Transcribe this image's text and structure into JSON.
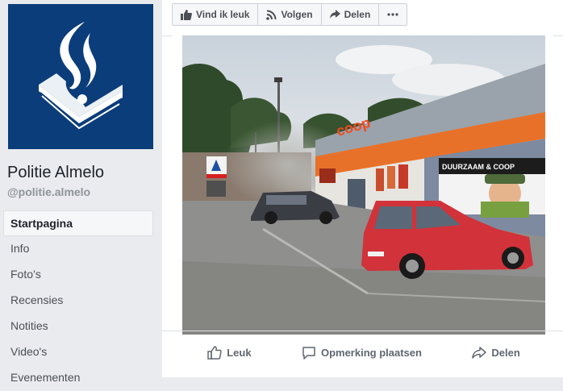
{
  "page": {
    "name": "Politie Almelo",
    "handle": "@politie.almelo"
  },
  "nav": {
    "items": [
      {
        "label": "Startpagina",
        "active": true
      },
      {
        "label": "Info"
      },
      {
        "label": "Foto’s"
      },
      {
        "label": "Recensies"
      },
      {
        "label": "Notities"
      },
      {
        "label": "Video's"
      },
      {
        "label": "Evenementen"
      }
    ]
  },
  "actions": {
    "like": "Vind ik leuk",
    "follow": "Volgen",
    "share": "Delen",
    "more_icon": "more-icon"
  },
  "post": {
    "photo": {
      "sign_left": "DUURZAAM & COOP",
      "shop_logo": "coop"
    },
    "footer": {
      "like": "Leuk",
      "comment": "Opmerking plaatsen",
      "share": "Delen"
    }
  },
  "colors": {
    "brand_blue": "#0b3d7a",
    "background": "#e9ebee",
    "text_dark": "#1d2129",
    "text_muted": "#90949c"
  }
}
